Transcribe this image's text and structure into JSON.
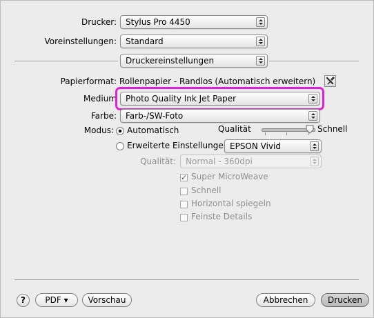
{
  "drucker": {
    "label": "Drucker:",
    "value": "Stylus Pro 4450"
  },
  "voreinstellungen": {
    "label": "Voreinstellungen:",
    "value": "Standard"
  },
  "panel": {
    "value": "Druckereinstellungen"
  },
  "papierformat": {
    "label": "Papierformat:",
    "value": "Rollenpapier - Randlos (Automatisch erweitern)"
  },
  "medium": {
    "label": "Medium",
    "value": "Photo Quality Ink Jet Paper"
  },
  "farbe": {
    "label": "Farbe:",
    "value": "Farb-/SW-Foto"
  },
  "modus": {
    "label": "Modus:",
    "auto_label": "Automatisch",
    "slider_label": "Qualität",
    "slider_end_label": "Schnell",
    "slider_level": 1.0,
    "advanced_label": "Erweiterte Einstellungen",
    "advanced_value": "EPSON Vivid",
    "selected": "Automatisch"
  },
  "qualitaet": {
    "label": "Qualität:",
    "value": "Normal - 360dpi"
  },
  "options": [
    {
      "label": "Super MicroWeave",
      "checked": true
    },
    {
      "label": "Schnell",
      "checked": false
    },
    {
      "label": "Horizontal spiegeln",
      "checked": false
    },
    {
      "label": "Feinste Details",
      "checked": false
    }
  ],
  "footer": {
    "help": "?",
    "pdf_label": "PDF ▾",
    "preview_label": "Vorschau",
    "cancel_label": "Abbrechen",
    "print_label": "Drucken"
  },
  "colors": {
    "highlight": "#e020d8",
    "background": "#ececec"
  }
}
